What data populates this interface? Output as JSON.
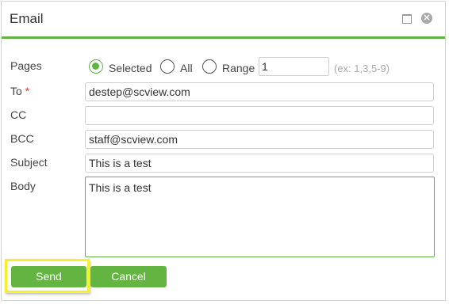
{
  "dialog": {
    "title": "Email"
  },
  "pages": {
    "label": "Pages",
    "options": [
      {
        "label": "Selected",
        "selected": true
      },
      {
        "label": "All",
        "selected": false
      },
      {
        "label": "Range",
        "selected": false
      }
    ],
    "range_value": "1",
    "range_hint": "(ex: 1,3,5-9)"
  },
  "fields": {
    "to": {
      "label": "To",
      "required_mark": "*",
      "value": "destep@scview.com"
    },
    "cc": {
      "label": "CC",
      "value": ""
    },
    "bcc": {
      "label": "BCC",
      "value": "staff@scview.com"
    },
    "subject": {
      "label": "Subject",
      "value": "This is a test"
    },
    "body": {
      "label": "Body",
      "value": "This is a test"
    }
  },
  "buttons": {
    "send": "Send",
    "cancel": "Cancel"
  },
  "colors": {
    "accent": "#5fb442",
    "highlight": "#f4f030"
  }
}
